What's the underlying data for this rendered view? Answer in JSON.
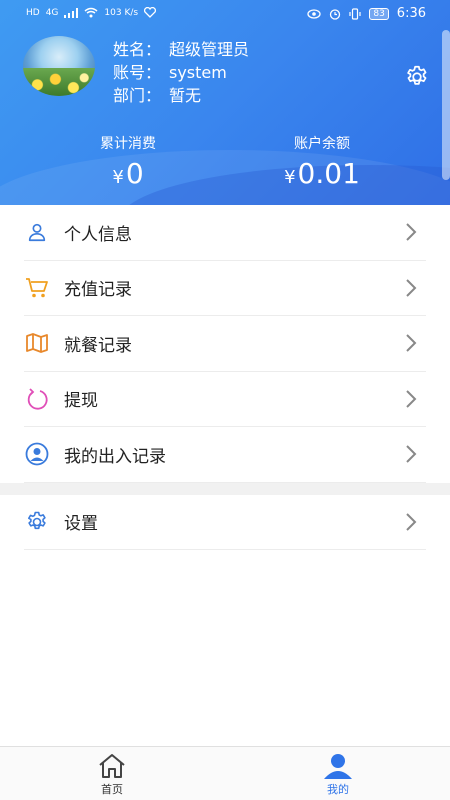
{
  "status_bar": {
    "left": [
      "HD",
      "4G",
      "103 K/s"
    ],
    "battery": "83",
    "time": "6:36"
  },
  "profile": {
    "name_label": "姓名：",
    "name_value": "超级管理员",
    "account_label": "账号：",
    "account_value": "system",
    "dept_label": "部门：",
    "dept_value": "暂无"
  },
  "stats": {
    "consume_label": "累计消费",
    "consume_value": "0",
    "balance_label": "账户余额",
    "balance_value": "0.01",
    "currency": "¥"
  },
  "menu": {
    "items": [
      {
        "label": "个人信息",
        "icon": "person-icon",
        "color": "#3a7bdc"
      },
      {
        "label": "充值记录",
        "icon": "cart-icon",
        "color": "#f0a020"
      },
      {
        "label": "就餐记录",
        "icon": "map-icon",
        "color": "#e8882b"
      },
      {
        "label": "提现",
        "icon": "refresh-icon",
        "color": "#e04fb8"
      },
      {
        "label": "我的出入记录",
        "icon": "user-circle-icon",
        "color": "#3a7bdc"
      }
    ],
    "settings": {
      "label": "设置",
      "icon": "gear-icon",
      "color": "#3a7bdc"
    }
  },
  "bottom_nav": {
    "home_label": "首页",
    "mine_label": "我的",
    "active_color": "#2f74e8"
  }
}
